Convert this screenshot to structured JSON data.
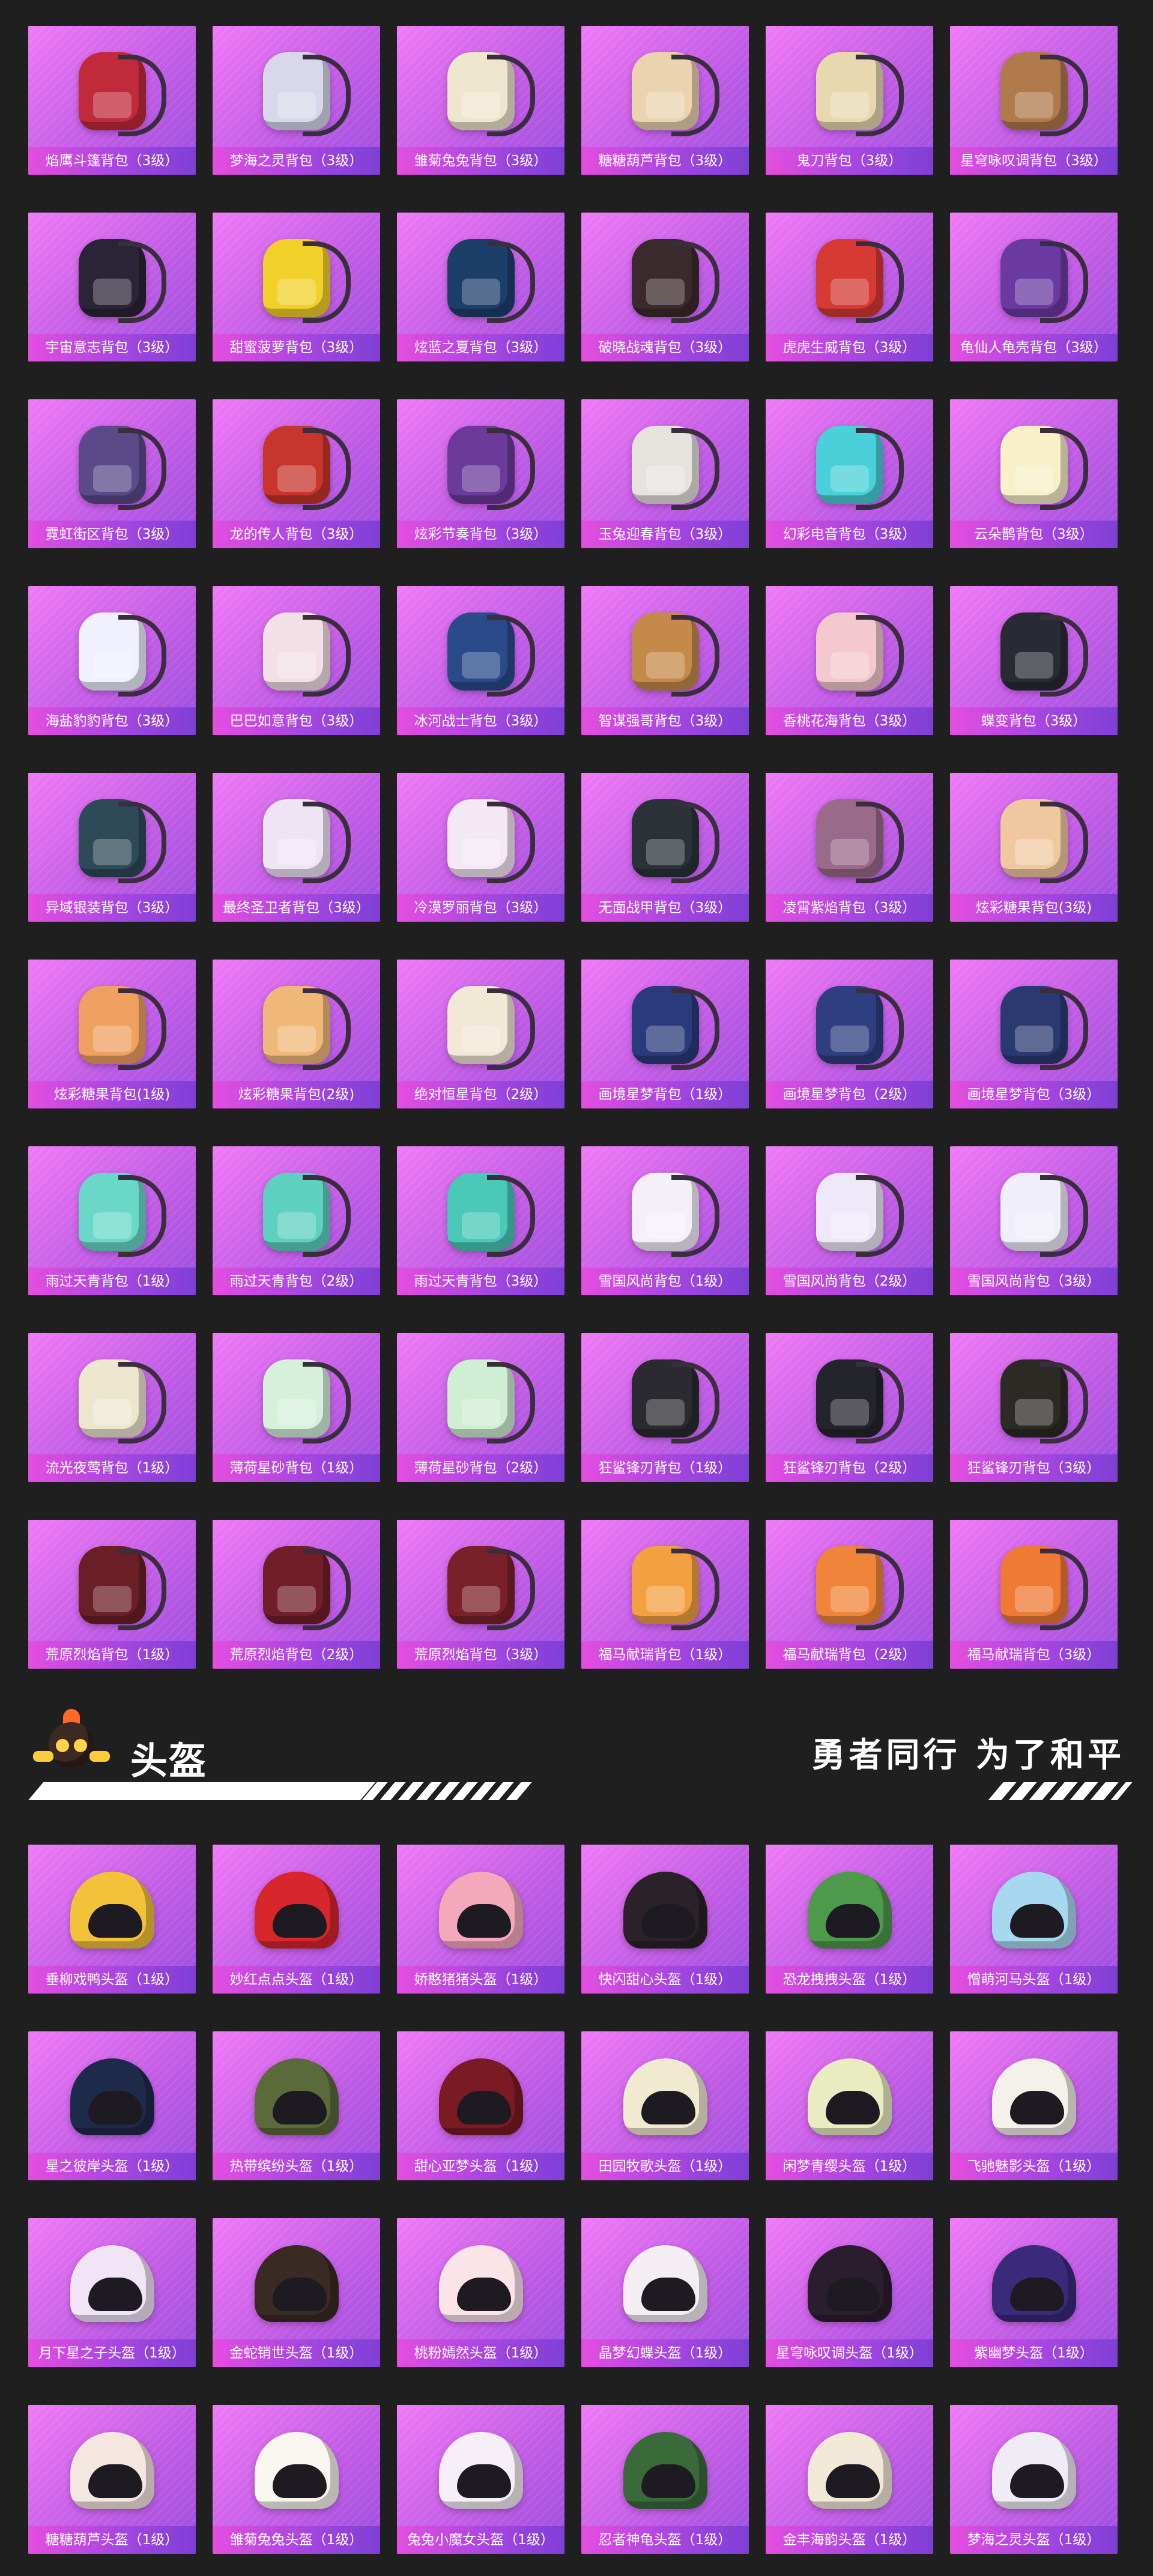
{
  "backpacks": [
    {
      "name": "焰鹰斗篷背包（3级）",
      "color": "#c02a3a"
    },
    {
      "name": "梦海之灵背包（3级）",
      "color": "#d8d8ea"
    },
    {
      "name": "雏菊兔兔背包（3级）",
      "color": "#efe6cf"
    },
    {
      "name": "糖糖葫芦背包（3级）",
      "color": "#ebd3b0"
    },
    {
      "name": "鬼刀背包（3级）",
      "color": "#e8d8b0"
    },
    {
      "name": "星穹咏叹调背包（3级）",
      "color": "#b07a4c"
    },
    {
      "name": "宇宙意志背包（3级）",
      "color": "#2b2436"
    },
    {
      "name": "甜蜜菠萝背包（3级）",
      "color": "#f1d02a"
    },
    {
      "name": "炫蓝之夏背包（3级）",
      "color": "#1e3e6a"
    },
    {
      "name": "破晓战魂背包（3级）",
      "color": "#3a2a2e"
    },
    {
      "name": "虎虎生威背包（3级）",
      "color": "#d63a33"
    },
    {
      "name": "龟仙人龟壳背包（3级）",
      "color": "#6a3aa2"
    },
    {
      "name": "霓虹街区背包（3级）",
      "color": "#5a4a8a"
    },
    {
      "name": "龙的传人背包（3级）",
      "color": "#c7352c"
    },
    {
      "name": "炫彩节奏背包（3级）",
      "color": "#6b3a9a"
    },
    {
      "name": "玉兔迎春背包（3级）",
      "color": "#e6e2de"
    },
    {
      "name": "幻彩电音背包（3级）",
      "color": "#4ad0d8"
    },
    {
      "name": "云朵鹊背包（3级）",
      "color": "#f7f0c8"
    },
    {
      "name": "海盐豹豹背包（3级）",
      "color": "#f0f0ff"
    },
    {
      "name": "巴巴如意背包（3级）",
      "color": "#f2e0e6"
    },
    {
      "name": "冰河战士背包（3级）",
      "color": "#2a4a8a"
    },
    {
      "name": "智谋强哥背包（3级）",
      "color": "#c58a4a"
    },
    {
      "name": "香桃花海背包（3级）",
      "color": "#f4c8cf"
    },
    {
      "name": "蝶变背包（3级）",
      "color": "#2a2a34"
    },
    {
      "name": "异域银装背包（3级）",
      "color": "#2e4a58"
    },
    {
      "name": "最终圣卫者背包（3级）",
      "color": "#efe4f4"
    },
    {
      "name": "冷漠罗丽背包（3级）",
      "color": "#f4e8f4"
    },
    {
      "name": "无面战甲背包（3级）",
      "color": "#2a3238"
    },
    {
      "name": "凌霄紫焰背包（3级）",
      "color": "#9a6a8a"
    },
    {
      "name": "炫彩糖果背包(3级)",
      "color": "#f0c8a0"
    },
    {
      "name": "炫彩糖果背包(1级)",
      "color": "#f0a060"
    },
    {
      "name": "炫彩糖果背包(2级)",
      "color": "#f0b878"
    },
    {
      "name": "绝对恒星背包（2级）",
      "color": "#f2e8d6"
    },
    {
      "name": "画境星梦背包（1级）",
      "color": "#2a3a7a"
    },
    {
      "name": "画境星梦背包（2级）",
      "color": "#2e3e80"
    },
    {
      "name": "画境星梦背包（3级）",
      "color": "#2a3a70"
    },
    {
      "name": "雨过天青背包（1级）",
      "color": "#6ad8c8"
    },
    {
      "name": "雨过天青背包（2级）",
      "color": "#5ed0c0"
    },
    {
      "name": "雨过天青背包（3级）",
      "color": "#4ac8b8"
    },
    {
      "name": "雪国风尚背包（1级）",
      "color": "#f4f0fa"
    },
    {
      "name": "雪国风尚背包（2级）",
      "color": "#eee8f8"
    },
    {
      "name": "雪国风尚背包（3级）",
      "color": "#f0eefa"
    },
    {
      "name": "流光夜莺背包（1级）",
      "color": "#ece6cf"
    },
    {
      "name": "薄荷星砂背包（1级）",
      "color": "#d6f0dc"
    },
    {
      "name": "薄荷星砂背包（2级）",
      "color": "#cfeed4"
    },
    {
      "name": "狂鲨锋刃背包（1级）",
      "color": "#2a2a30"
    },
    {
      "name": "狂鲨锋刃背包（2级）",
      "color": "#24242c"
    },
    {
      "name": "狂鲨锋刃背包（3级）",
      "color": "#2c2a24"
    },
    {
      "name": "荒原烈焰背包（1级）",
      "color": "#6a1e26"
    },
    {
      "name": "荒原烈焰背包（2级）",
      "color": "#721e28"
    },
    {
      "name": "荒原烈焰背包（3级）",
      "color": "#7a2028"
    },
    {
      "name": "福马献瑞背包（1级）",
      "color": "#f2a040"
    },
    {
      "name": "福马献瑞背包（2级）",
      "color": "#f0843a"
    },
    {
      "name": "福马献瑞背包（3级）",
      "color": "#ee7a34"
    }
  ],
  "section": {
    "title": "头盔",
    "slogan": "勇者同行 为了和平"
  },
  "helmets": [
    {
      "name": "垂柳戏鸭头盔（1级）",
      "color": "#f2c23a"
    },
    {
      "name": "妙红点点头盔（1级）",
      "color": "#d7262c"
    },
    {
      "name": "娇憨猪猪头盔（1级）",
      "color": "#f4a8bc"
    },
    {
      "name": "快闪甜心头盔（1级）",
      "color": "#2a2228"
    },
    {
      "name": "恐龙拽拽头盔（1级）",
      "color": "#4c9a4a"
    },
    {
      "name": "憎萌河马头盔（1级）",
      "color": "#a8d8f0"
    },
    {
      "name": "星之彼岸头盔（1级）",
      "color": "#1e2a4a"
    },
    {
      "name": "热带缤纷头盔（1级）",
      "color": "#5a6a3a"
    },
    {
      "name": "甜心亚梦头盔（1级）",
      "color": "#7a1a22"
    },
    {
      "name": "田园牧歌头盔（1级）",
      "color": "#f0ead0"
    },
    {
      "name": "闲梦青缨头盔（1级）",
      "color": "#e8ecc0"
    },
    {
      "name": "飞驰魅影头盔（1级）",
      "color": "#f4f0ea"
    },
    {
      "name": "月下星之子头盔（1级）",
      "color": "#f0e4f6"
    },
    {
      "name": "金蛇销世头盔（1级）",
      "color": "#3a2a24"
    },
    {
      "name": "桃粉嫣然头盔（1级）",
      "color": "#fae4e8"
    },
    {
      "name": "晶梦幻蝶头盔（1级）",
      "color": "#f4eef4"
    },
    {
      "name": "星穹咏叹调头盔（1级）",
      "color": "#2a1e2e"
    },
    {
      "name": "紫幽梦头盔（1级）",
      "color": "#3a2a7a"
    },
    {
      "name": "糖糖葫芦头盔（1级）",
      "color": "#f4e6e0"
    },
    {
      "name": "雏菊兔兔头盔（1级）",
      "color": "#f8f6ee"
    },
    {
      "name": "兔兔小魔女头盔（1级）",
      "color": "#f6eef6"
    },
    {
      "name": "忍者神龟头盔（1级）",
      "color": "#3a6a3a"
    },
    {
      "name": "金丰海韵头盔（1级）",
      "color": "#f2e8d8"
    },
    {
      "name": "梦海之灵头盔（1级）",
      "color": "#f0ecf6"
    }
  ]
}
